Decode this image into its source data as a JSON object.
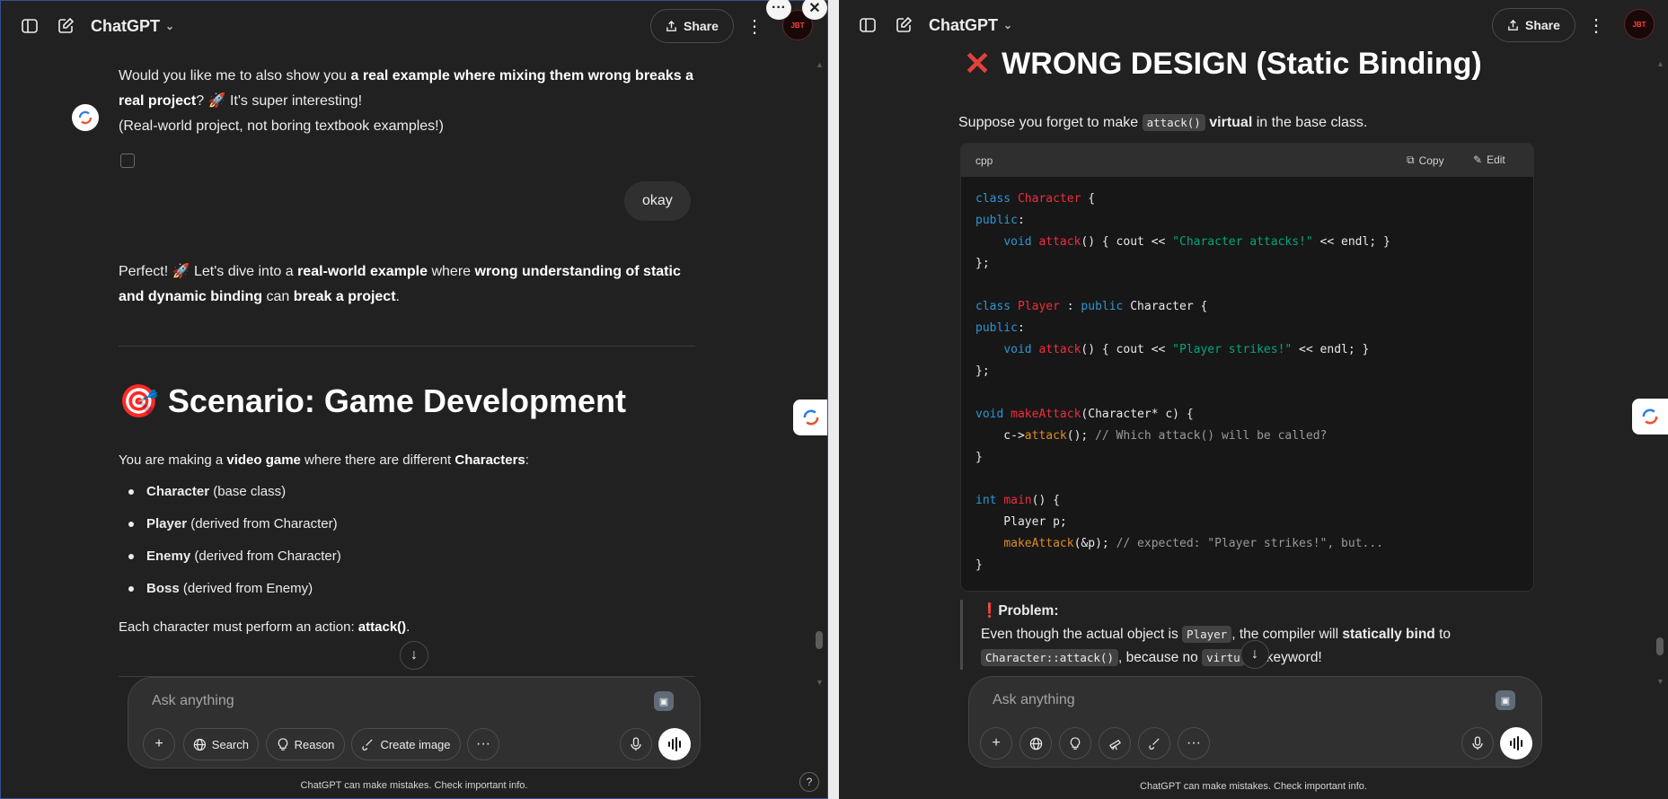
{
  "app_title": "ChatGPT",
  "share_label": "Share",
  "left": {
    "intro_p1": "Would you like me to also show you ",
    "intro_b1": "a real example where mixing them wrong breaks a real project",
    "intro_p2": "? 🚀 It's super interesting!",
    "intro_p3": "(Real-world project, not boring textbook examples!)",
    "user_msg": "okay",
    "perfect_1": "Perfect! 🚀 Let's dive into a ",
    "perfect_b1": "real-world example",
    "perfect_2": " where ",
    "perfect_b2": "wrong understanding of static and dynamic binding",
    "perfect_3": " can ",
    "perfect_b3": "break a project",
    "perfect_4": ".",
    "scenario_emoji": "🎯",
    "scenario_title": "Scenario: Game Development",
    "making_1": "You are making a ",
    "making_b1": "video game",
    "making_2": " where there are different ",
    "making_b2": "Characters",
    "making_3": ":",
    "list": [
      {
        "name": "Character",
        "desc": " (base class)"
      },
      {
        "name": "Player",
        "desc": " (derived from Character)"
      },
      {
        "name": "Enemy",
        "desc": " (derived from Character)"
      },
      {
        "name": "Boss",
        "desc": " (derived from Enemy)"
      }
    ],
    "each_1": "Each character must perform an action: ",
    "each_b1": "attack()",
    "each_2": ".",
    "composer_placeholder": "Ask anything",
    "pills": {
      "search": "Search",
      "reason": "Reason",
      "create_image": "Create image"
    }
  },
  "right": {
    "heading": "WRONG DESIGN (Static Binding)",
    "suppose_1": "Suppose you forget to make ",
    "suppose_code": "attack()",
    "suppose_b": " virtual",
    "suppose_2": " in the base class.",
    "code_lang": "cpp",
    "copy_label": "Copy",
    "edit_label": "Edit",
    "problem_label": "Problem:",
    "problem_1": "Even though the actual object is ",
    "problem_code1": "Player",
    "problem_2": ", the compiler will ",
    "problem_b1": "statically bind",
    "problem_3": " to ",
    "problem_code2": "Character::attack()",
    "problem_4": ", because no ",
    "problem_code3": "virtu",
    "problem_5": "keyword!",
    "composer_placeholder": "Ask anything"
  },
  "footer_text": "ChatGPT can make mistakes. Check important info.",
  "help_label": "?",
  "colors": {
    "bg": "#212121",
    "code_keyword": "#2e95d3",
    "code_type": "#f22c3d",
    "code_string": "#00a67d",
    "code_func": "#df8b26"
  }
}
